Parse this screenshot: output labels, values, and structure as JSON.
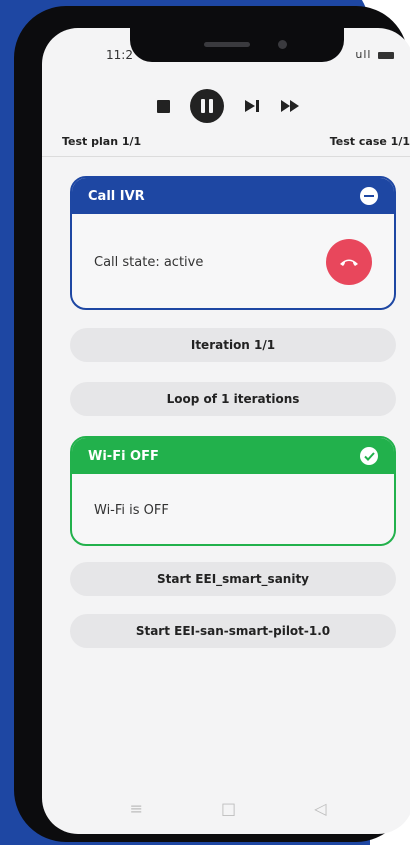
{
  "status_bar": {
    "time": "11:2",
    "icons": "ull"
  },
  "controls": {
    "stop": "stop-icon",
    "pause": "pause-icon",
    "next": "skip-next-icon",
    "fast_forward": "fast-forward-icon"
  },
  "plan": {
    "test_plan": "Test plan 1/1",
    "test_case": "Test case 1/1"
  },
  "cards": {
    "call_ivr": {
      "title": "Call IVR",
      "status_text": "Call state: active",
      "color": "#1e47a3",
      "header_icon": "minus-circle-icon",
      "action_icon": "hang-up-icon",
      "action_color": "#e8475c"
    },
    "wifi_off": {
      "title": "Wi-Fi OFF",
      "status_text": "Wi-Fi is OFF",
      "color": "#22b14c",
      "header_icon": "check-circle-icon"
    }
  },
  "pills": {
    "iteration": "Iteration 1/1",
    "loop": "Loop of 1 iterations",
    "start_sanity": "Start EEI_smart_sanity",
    "start_pilot": "Start EEI-san-smart-pilot-1.0"
  },
  "navbar": {
    "menu": "≡",
    "home": "□",
    "back": "◁"
  }
}
